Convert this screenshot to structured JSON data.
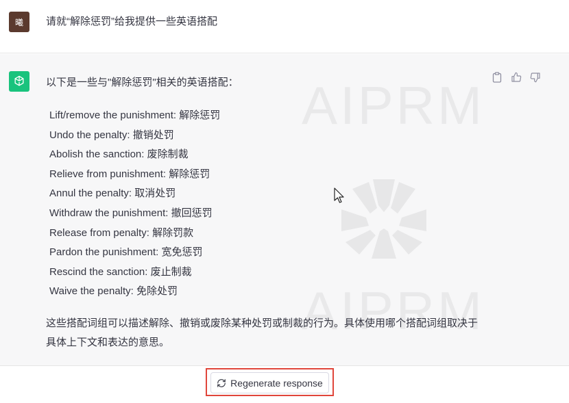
{
  "user_message": {
    "avatar_text": "曦",
    "text": "请就“解除惩罚”给我提供一些英语搭配"
  },
  "assistant_message": {
    "intro": "以下是一些与\"解除惩罚\"相关的英语搭配：",
    "items": [
      "Lift/remove the punishment: 解除惩罚",
      "Undo the penalty: 撤销处罚",
      "Abolish the sanction: 废除制裁",
      "Relieve from punishment: 解除惩罚",
      "Annul the penalty: 取消处罚",
      "Withdraw the punishment: 撤回惩罚",
      "Release from penalty: 解除罚款",
      "Pardon the punishment: 宽免惩罚",
      "Rescind the sanction: 废止制裁",
      "Waive the penalty: 免除处罚"
    ],
    "outro": "这些搭配词组可以描述解除、撤销或废除某种处罚或制裁的行为。具体使用哪个搭配词组取决于具体上下文和表达的意思。"
  },
  "watermark": {
    "text_top": "AIPRM",
    "text_bottom": "AIPRM"
  },
  "icons": {
    "copy": "clipboard-icon",
    "thumbs_up": "thumbs-up-icon",
    "thumbs_down": "thumbs-down-icon",
    "regenerate": "refresh-icon"
  },
  "bottom": {
    "regenerate_label": "Regenerate response"
  },
  "colors": {
    "gpt_green": "#19c37d",
    "user_avatar": "#5b3a2e",
    "highlight": "#e0453a",
    "assistant_bg": "#f7f7f8"
  }
}
